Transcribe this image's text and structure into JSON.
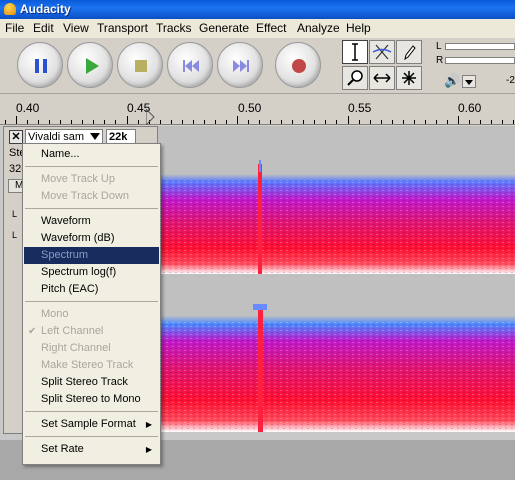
{
  "window": {
    "title": "Audacity"
  },
  "menubar": {
    "items": [
      "File",
      "Edit",
      "View",
      "Transport",
      "Tracks",
      "Generate",
      "Effect",
      "Analyze",
      "Help"
    ]
  },
  "toolbar": {
    "transport": [
      "pause-icon",
      "play-icon",
      "stop-icon",
      "skip-start-icon",
      "skip-end-icon",
      "record-icon"
    ],
    "tools": [
      "selection-tool-icon",
      "envelope-tool-icon",
      "draw-tool-icon",
      "zoom-tool-icon",
      "timeshift-tool-icon",
      "multi-tool-icon"
    ],
    "meter": {
      "left_label": "L",
      "right_label": "R",
      "scale_value": "-2",
      "speaker": "speaker-icon"
    }
  },
  "ruler": {
    "labels": [
      "0.40",
      "0.45",
      "0.50",
      "0.55",
      "0.60"
    ]
  },
  "track": {
    "close_label": "✕",
    "name": "Vivaldi sam",
    "rate": "22k",
    "obscured_lines": [
      "Ste",
      "32-",
      "M"
    ],
    "ctrl_marks": [
      "L",
      "L"
    ]
  },
  "context_menu": {
    "items": [
      {
        "label": "Name...",
        "disabled": false
      },
      {
        "sep": true
      },
      {
        "label": "Move Track Up",
        "disabled": true
      },
      {
        "label": "Move Track Down",
        "disabled": true
      },
      {
        "sep": true
      },
      {
        "label": "Waveform",
        "disabled": false
      },
      {
        "label": "Waveform (dB)",
        "disabled": false
      },
      {
        "label": "Spectrum",
        "disabled": true,
        "highlighted": true
      },
      {
        "label": "Spectrum log(f)",
        "disabled": false
      },
      {
        "label": "Pitch (EAC)",
        "disabled": false
      },
      {
        "sep": true
      },
      {
        "label": "Mono",
        "disabled": true
      },
      {
        "label": "Left Channel",
        "disabled": true,
        "checked": true
      },
      {
        "label": "Right Channel",
        "disabled": true
      },
      {
        "label": "Make Stereo Track",
        "disabled": true
      },
      {
        "label": "Split Stereo Track",
        "disabled": false
      },
      {
        "label": "Split Stereo to Mono",
        "disabled": false
      },
      {
        "sep": true
      },
      {
        "label": "Set Sample Format",
        "disabled": false,
        "submenu": true
      },
      {
        "sep": true
      },
      {
        "label": "Set Rate",
        "disabled": false,
        "submenu": true
      }
    ]
  },
  "colors": {
    "titlebar": "#0a5ad8",
    "highlight": "#182c5e",
    "spectrum_hot": "#ff1030",
    "spectrum_mid": "#c010c0",
    "spectrum_cool": "#3a6aff"
  }
}
